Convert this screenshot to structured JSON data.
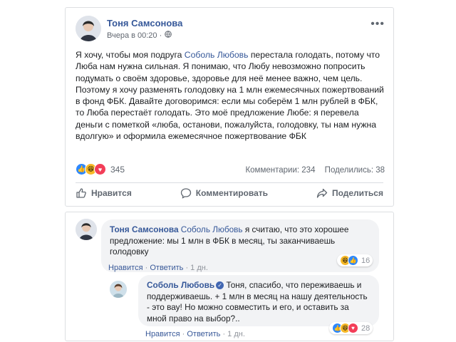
{
  "post": {
    "author": "Тоня Самсонова",
    "time": "Вчера в 00:20 ·",
    "privacy_icon": "globe-icon",
    "text_before_mention": "Я хочу, чтобы моя подруга ",
    "mention": "Соболь Любовь",
    "text_after_mention": " перестала голодать, потому что Люба нам нужна сильная. Я понимаю, что Любу невозможно попросить подумать о своём здоровье, здоровье для неё менее важно, чем цель. Поэтому я хочу разменять голодовку на 1 млн ежемесячных пожертвований в фонд ФБК. Давайте договоримся: если мы соберём 1 млн рублей в ФБК, то Люба перестаёт голодать. Это моё предложение Любе: я перевела деньги с пометкой «люба, останови, пожалуйста, голодовку, ты нам нужна вдолгую» и оформила ежемесячное пожертвование ФБК",
    "reaction_count": "345",
    "comments_stat": "Комментарии: 234",
    "shares_stat": "Поделились: 38",
    "actions": {
      "like": "Нравится",
      "comment": "Комментировать",
      "share": "Поделиться"
    }
  },
  "comments": [
    {
      "author": "Тоня Самсонова",
      "mention": "Соболь Любовь",
      "text": " я считаю, что это хорошее предложение: мы 1 млн в ФБК в месяц, ты заканчиваешь голодовку",
      "reactions": "16",
      "like": "Нравится",
      "reply": "Ответить",
      "time": "1 дн."
    },
    {
      "author": "Соболь Любовь",
      "text": "Тоня, спасибо, что переживаешь и поддерживаешь. + 1 млн в месяц на нашу деятельность - это вау! Но можно совместить и его, и оставить за мной право на выбор?..",
      "reactions": "28",
      "like": "Нравится",
      "reply": "Ответить",
      "time": "1 дн."
    }
  ],
  "colors": {
    "link": "#365899",
    "like": "#2d88ff",
    "wow": "#f7b928",
    "love": "#f33e58"
  }
}
